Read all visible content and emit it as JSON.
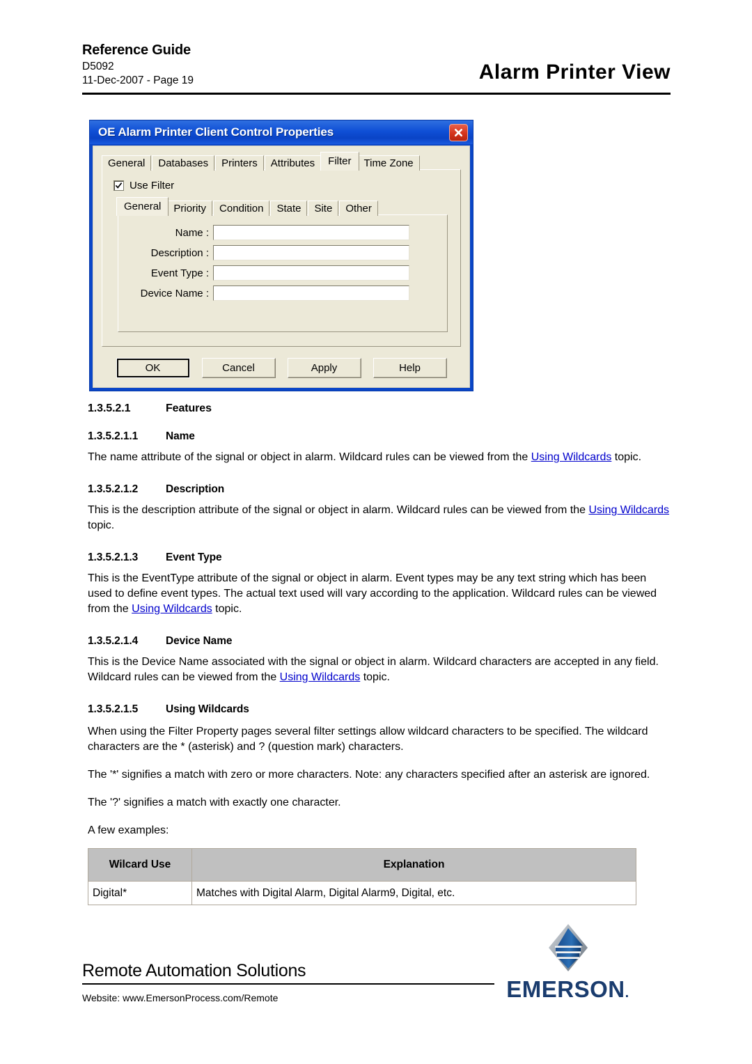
{
  "header": {
    "guide": "Reference Guide",
    "doc_number": "D5092",
    "date_page": "11-Dec-2007 - Page 19",
    "title": "Alarm Printer View"
  },
  "dialog": {
    "title": "OE Alarm Printer Client Control Properties",
    "close_label": "Close",
    "outer_tabs": [
      {
        "label": "General",
        "active": false
      },
      {
        "label": "Databases",
        "active": false
      },
      {
        "label": "Printers",
        "active": false
      },
      {
        "label": "Attributes",
        "active": false
      },
      {
        "label": "Filter",
        "active": true
      },
      {
        "label": "Time Zone",
        "active": false
      }
    ],
    "use_filter": {
      "label": "Use Filter",
      "checked": true
    },
    "inner_tabs": [
      {
        "label": "General",
        "active": true
      },
      {
        "label": "Priority",
        "active": false
      },
      {
        "label": "Condition",
        "active": false
      },
      {
        "label": "State",
        "active": false
      },
      {
        "label": "Site",
        "active": false
      },
      {
        "label": "Other",
        "active": false
      }
    ],
    "fields": [
      {
        "label": "Name :",
        "value": ""
      },
      {
        "label": "Description :",
        "value": ""
      },
      {
        "label": "Event Type :",
        "value": ""
      },
      {
        "label": "Device Name :",
        "value": ""
      }
    ],
    "buttons": [
      {
        "label": "OK",
        "default": true
      },
      {
        "label": "Cancel",
        "default": false
      },
      {
        "label": "Apply",
        "default": false
      },
      {
        "label": "Help",
        "default": false
      }
    ],
    "colors": {
      "titlebar": "#0f4fd6",
      "face": "#ece9d8",
      "close": "#d4331c"
    }
  },
  "content": {
    "features": {
      "num": "1.3.5.2.1",
      "title": "Features"
    },
    "name": {
      "num": "1.3.5.2.1.1",
      "title": "Name",
      "text_a": "The name attribute of the signal or object in alarm. Wildcard rules can be viewed from the ",
      "link": "Using Wildcards",
      "text_b": " topic."
    },
    "description": {
      "num": "1.3.5.2.1.2",
      "title": "Description",
      "text_a": "This is the description attribute of the signal or object in alarm. Wildcard rules can be viewed from the ",
      "link": "Using Wildcards",
      "text_b": " topic."
    },
    "event_type": {
      "num": "1.3.5.2.1.3",
      "title": "Event Type",
      "text_a": "This is the EventType attribute of the signal or object in alarm. Event types may be any text string which has been used to define event types. The actual text used will vary according to the application. Wildcard rules can be viewed from the ",
      "link": "Using Wildcards",
      "text_b": " topic."
    },
    "device_name": {
      "num": "1.3.5.2.1.4",
      "title": "Device Name",
      "text_a": "This is the Device Name associated with the signal or object in alarm. Wildcard characters are accepted in any field. Wildcard rules can be viewed from the ",
      "link": "Using Wildcards",
      "text_b": " topic."
    },
    "using_wildcards": {
      "num": "1.3.5.2.1.5",
      "title": "Using Wildcards",
      "para1": "When using the Filter Property pages several filter settings allow wildcard characters to be specified. The wildcard characters are the * (asterisk) and ? (question mark) characters.",
      "para2": "The '*' signifies a match with zero or more characters. Note: any characters specified after an asterisk are ignored.",
      "para3": "The '?' signifies a match with exactly one character.",
      "para4": "A few examples:"
    },
    "table": {
      "headers": [
        "Wilcard Use",
        "Explanation"
      ],
      "rows": [
        [
          "Digital*",
          "Matches with Digital Alarm, Digital Alarm9, Digital, etc."
        ]
      ]
    }
  },
  "footer": {
    "ras": "Remote Automation Solutions",
    "website": "Website:  www.EmersonProcess.com/Remote",
    "brand": "EMERSON",
    "brand_dot": "."
  }
}
